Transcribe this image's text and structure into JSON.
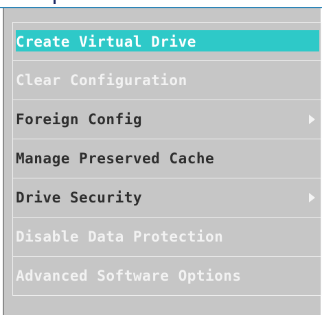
{
  "menu": {
    "items": [
      {
        "label": "Create Virtual Drive",
        "state": "selected",
        "submenu": false
      },
      {
        "label": "Clear Configuration",
        "state": "disabled",
        "submenu": false
      },
      {
        "label": "Foreign Config",
        "state": "enabled",
        "submenu": true
      },
      {
        "label": "Manage Preserved Cache",
        "state": "enabled",
        "submenu": false
      },
      {
        "label": "Drive Security",
        "state": "enabled",
        "submenu": true
      },
      {
        "label": "Disable Data Protection",
        "state": "disabled",
        "submenu": false
      },
      {
        "label": "Advanced Software Options",
        "state": "disabled",
        "submenu": false
      }
    ]
  },
  "colors": {
    "menu_background": "#c6c6c6",
    "highlight": "#2ec9c8",
    "enabled_text": "#2e2e2e",
    "disabled_text": "#f2f2f2",
    "divider": "#f0f0f0",
    "top_border": "#2e86b8"
  },
  "icons": {
    "submenu": "triangle-right-icon"
  }
}
